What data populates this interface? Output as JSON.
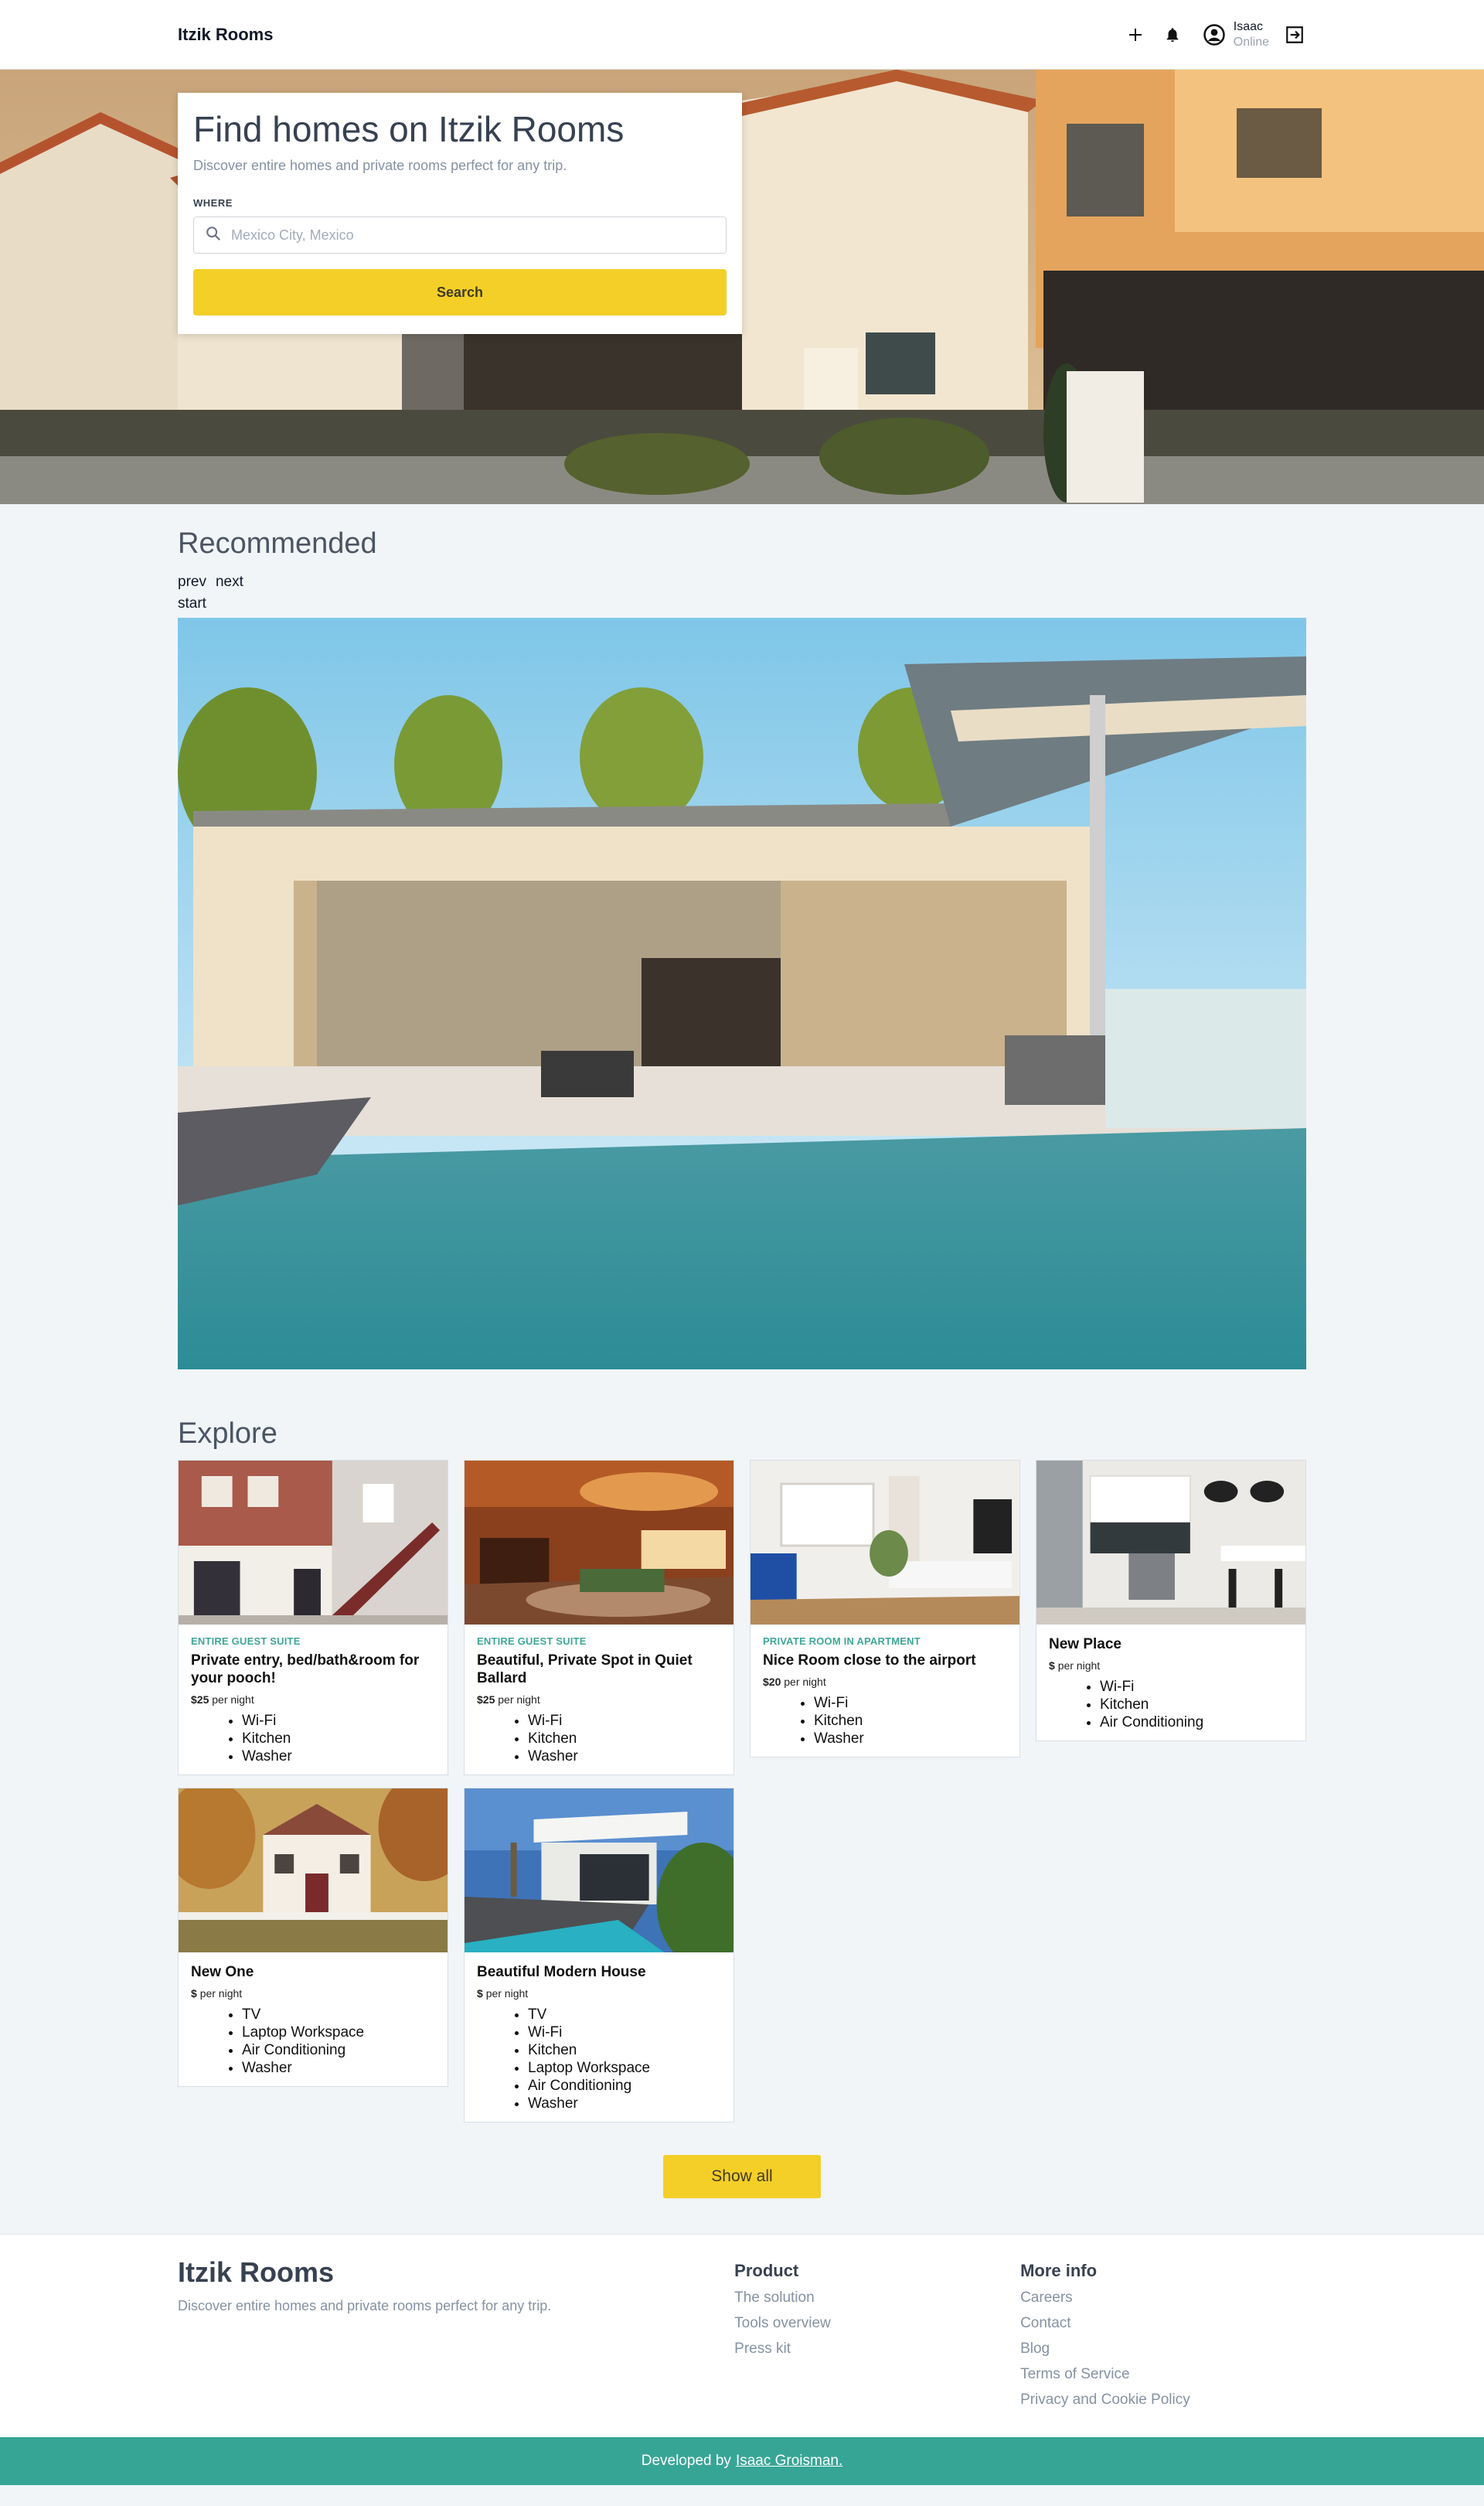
{
  "nav": {
    "brand": "Itzik Rooms",
    "user_name": "Isaac",
    "user_status": "Online",
    "icons": [
      "plus-icon",
      "bell-icon",
      "account-circle-icon",
      "logout-icon"
    ]
  },
  "hero": {
    "title": "Find homes on Itzik Rooms",
    "subtitle": "Discover entire homes and private rooms perfect for any trip.",
    "where_label": "WHERE",
    "search_placeholder": "Mexico City, Mexico",
    "search_value": "",
    "search_button": "Search"
  },
  "recommended": {
    "title": "Recommended",
    "prev": "prev",
    "next": "next",
    "start": "start"
  },
  "explore": {
    "title": "Explore",
    "listings": [
      {
        "type": "ENTIRE GUEST SUITE",
        "title": "Private entry, bed/bath&room for your pooch!",
        "price": "$25",
        "price_suffix": "per night",
        "amenities": [
          "Wi-Fi",
          "Kitchen",
          "Washer"
        ]
      },
      {
        "type": "ENTIRE GUEST SUITE",
        "title": "Beautiful, Private Spot in Quiet Ballard",
        "price": "$25",
        "price_suffix": "per night",
        "amenities": [
          "Wi-Fi",
          "Kitchen",
          "Washer"
        ]
      },
      {
        "type": "PRIVATE ROOM IN APARTMENT",
        "title": "Nice Room close to the airport",
        "price": "$20",
        "price_suffix": "per night",
        "amenities": [
          "Wi-Fi",
          "Kitchen",
          "Washer"
        ]
      },
      {
        "type": "",
        "title": "New Place",
        "price": "$",
        "price_suffix": "per night",
        "amenities": [
          "Wi-Fi",
          "Kitchen",
          "Air Conditioning"
        ]
      },
      {
        "type": "",
        "title": "New One",
        "price": "$",
        "price_suffix": "per night",
        "amenities": [
          "TV",
          "Laptop Workspace",
          "Air Conditioning",
          "Washer"
        ]
      },
      {
        "type": "",
        "title": "Beautiful Modern House",
        "price": "$",
        "price_suffix": "per night",
        "amenities": [
          "TV",
          "Wi-Fi",
          "Kitchen",
          "Laptop Workspace",
          "Air Conditioning",
          "Washer"
        ]
      }
    ],
    "show_all": "Show all"
  },
  "footer": {
    "brand": "Itzik Rooms",
    "tagline": "Discover entire homes and private rooms perfect for any trip.",
    "product_title": "Product",
    "product_links": [
      "The solution",
      "Tools overview",
      "Press kit"
    ],
    "more_title": "More info",
    "more_links": [
      "Careers",
      "Contact",
      "Blog",
      "Terms of Service",
      "Privacy and Cookie Policy"
    ],
    "developed_by": "Developed by",
    "developer": "Isaac Groisman."
  },
  "colors": {
    "accent_yellow": "#f4cf27",
    "accent_teal": "#37a596",
    "page_bg": "#f1f5f8"
  }
}
